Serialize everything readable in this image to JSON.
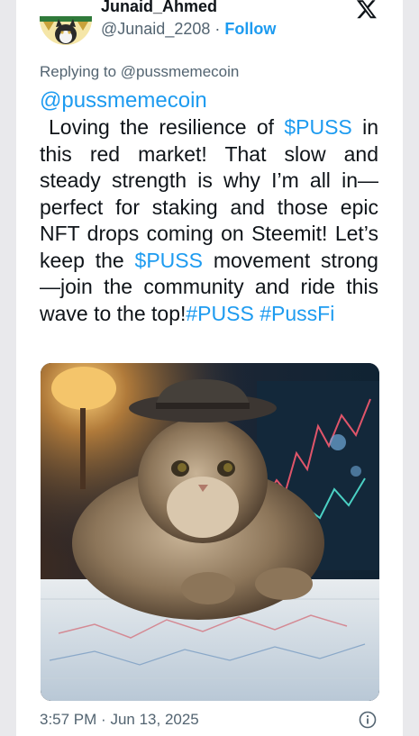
{
  "user": {
    "name": "Junaid_Ahmed",
    "handle": "@Junaid_2208",
    "separator": "·",
    "follow_label": "Follow"
  },
  "reply": {
    "replying_to": "Replying to @pussmemecoin"
  },
  "tweet": {
    "mention": "@pussmemecoin",
    "seg1": "Loving the resilience of ",
    "tag1": "$PUSS",
    "seg2": " in this red market!  That slow and steady strength is why I’m all in—perfect for staking and those epic NFT drops coming on Steemit! Let’s keep the ",
    "tag2": "$PUSS",
    "seg3": " movement strong—join the community and ride this wave to the top!",
    "tag3": "#PUSS",
    "tag4": "#PussFi"
  },
  "timestamp": {
    "time": "3:57 PM",
    "separator": "·",
    "date": "Jun 13, 2025"
  },
  "icons": {
    "platform_logo": "x-logo-icon",
    "info": "info-icon"
  },
  "colors": {
    "accent": "#1d9bf0",
    "text": "#0f1419",
    "secondary": "#536471"
  }
}
